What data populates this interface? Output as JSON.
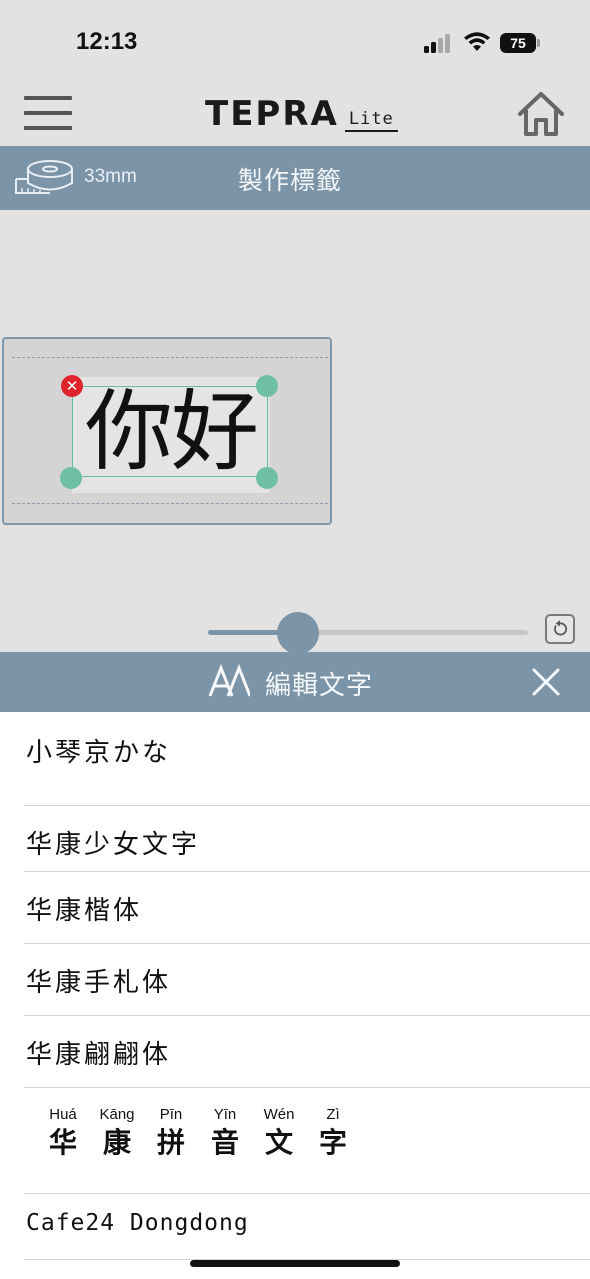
{
  "status_bar": {
    "time": "12:13",
    "battery": "75"
  },
  "header": {
    "logo_main": "TEPRA",
    "logo_sub": "Lite"
  },
  "toolbar": {
    "tape_width": "33mm",
    "title": "製作標籤"
  },
  "label_editor": {
    "text": "你好"
  },
  "size_slider": {
    "value_fraction": 0.28
  },
  "panel": {
    "title": "編輯文字"
  },
  "fonts": [
    {
      "name": "小琴京かな"
    },
    {
      "name": "华康少女文字"
    },
    {
      "name": "华康楷体"
    },
    {
      "name": "华康手札体"
    },
    {
      "name": "华康翩翩体"
    },
    {
      "pinyin": [
        {
          "roman": "Huá",
          "han": "华"
        },
        {
          "roman": "Kāng",
          "han": "康"
        },
        {
          "roman": "Pīn",
          "han": "拼"
        },
        {
          "roman": "Yīn",
          "han": "音"
        },
        {
          "roman": "Wén",
          "han": "文"
        },
        {
          "roman": "Zì",
          "han": "字"
        }
      ]
    },
    {
      "name": "Cafe24 Dongdong"
    }
  ],
  "colors": {
    "accent": "#7b94a8",
    "handle": "#6fbfa6",
    "delete": "#e0242b"
  }
}
